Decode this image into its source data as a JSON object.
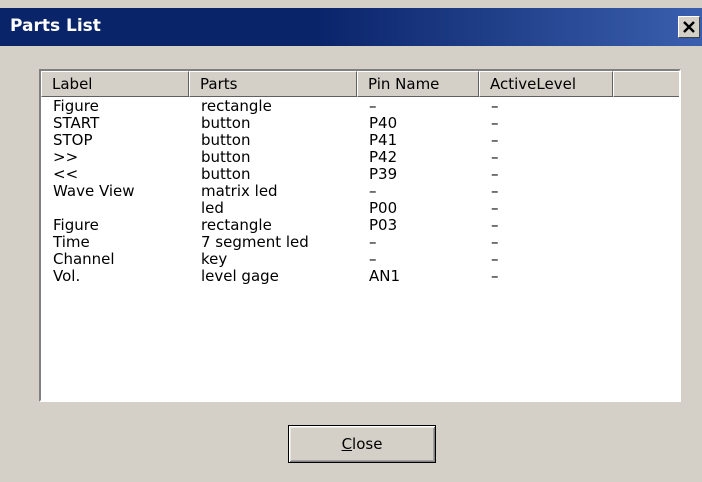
{
  "window": {
    "title": "Parts List",
    "close_glyph": "✕"
  },
  "list": {
    "columns": [
      "Label",
      "Parts",
      "Pin Name",
      "ActiveLevel"
    ],
    "rows": [
      [
        "Figure",
        "rectangle",
        "–",
        "–"
      ],
      [
        "START",
        "button",
        "P40",
        "–"
      ],
      [
        "STOP",
        "button",
        "P41",
        "–"
      ],
      [
        ">>",
        "button",
        "P42",
        "–"
      ],
      [
        "<<",
        "button",
        "P39",
        "–"
      ],
      [
        "Wave View",
        "matrix led",
        "–",
        "–"
      ],
      [
        "",
        "led",
        "P00",
        "–"
      ],
      [
        "Figure",
        "rectangle",
        "P03",
        "–"
      ],
      [
        "Time",
        "7 segment led",
        "–",
        "–"
      ],
      [
        "Channel",
        "key",
        "–",
        "–"
      ],
      [
        "Vol.",
        "level gage",
        "AN1",
        "–"
      ]
    ]
  },
  "buttons": {
    "close_label": "Close",
    "close_mnemonic": "C",
    "close_rest": "lose"
  }
}
